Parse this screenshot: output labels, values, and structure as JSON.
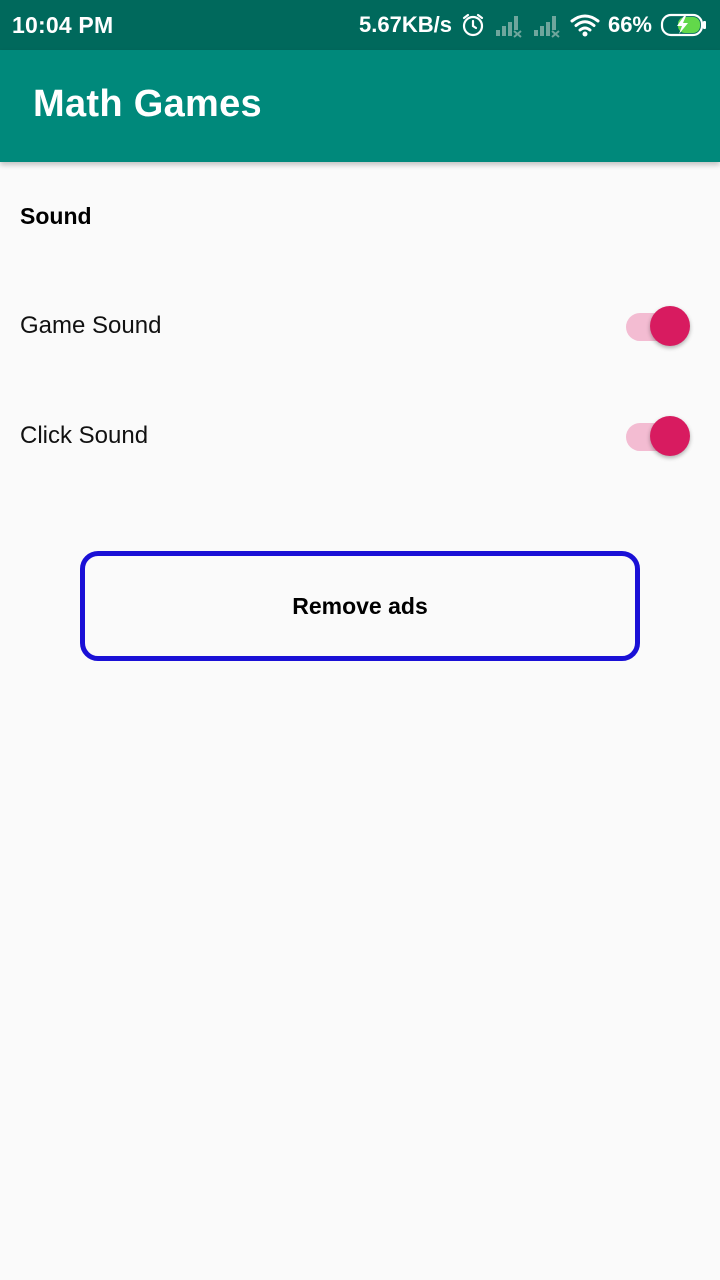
{
  "status_bar": {
    "time": "10:04 PM",
    "net_speed": "5.67KB/s",
    "battery_percent": "66%",
    "icons": [
      "alarm-icon",
      "signal-icon",
      "signal-icon",
      "wifi-icon",
      "battery-charging-icon"
    ]
  },
  "app_bar": {
    "title": "Math Games",
    "color": "#00897b"
  },
  "settings": {
    "section_title": "Sound",
    "items": [
      {
        "label": "Game Sound",
        "enabled": true
      },
      {
        "label": "Click Sound",
        "enabled": true
      }
    ],
    "accent_color": "#d81b60"
  },
  "remove_ads": {
    "label": "Remove ads",
    "border_color": "#1a10d6"
  }
}
